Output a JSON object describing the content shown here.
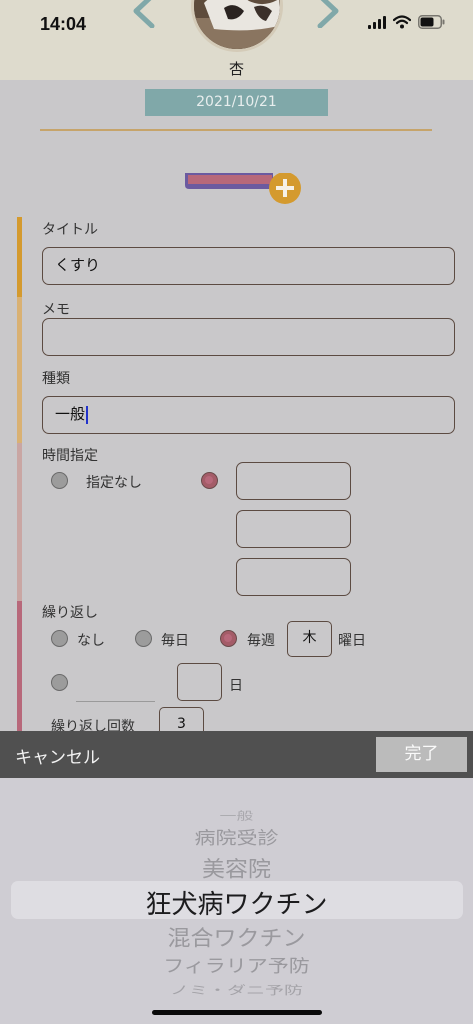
{
  "status": {
    "time": "14:04"
  },
  "header": {
    "pet_name": "杏"
  },
  "form": {
    "date": "2021/10/21",
    "title_label": "タイトル",
    "title_value": "くすり",
    "memo_label": "メモ",
    "memo_value": "",
    "kind_label": "種類",
    "kind_value": "一般",
    "time_label": "時間指定",
    "time_none": "指定なし",
    "repeat_label": "繰り返し",
    "repeat_none": "なし",
    "repeat_daily": "毎日",
    "repeat_weekly": "毎週",
    "weekday_value": "木",
    "weekday_suffix": "曜日",
    "day_suffix": "日",
    "repeat_count_label": "繰り返し回数",
    "repeat_count_value": "3"
  },
  "toolbar": {
    "cancel_label": "キャンセル",
    "done_label": "完了"
  },
  "picker": {
    "options": [
      "一般",
      "病院受診",
      "美容院",
      "狂犬病ワクチン",
      "混合ワクチン",
      "フィラリア予防",
      "ノミ・ダニ予防"
    ],
    "selected": "狂犬病ワクチン"
  },
  "colors": {
    "date_bg": "#80a8a9",
    "accent_gold": "#d49a2e",
    "accent_rose": "#b7687a",
    "bar_tan": "#d9b173",
    "bar_pink": "#c9a6a3"
  }
}
